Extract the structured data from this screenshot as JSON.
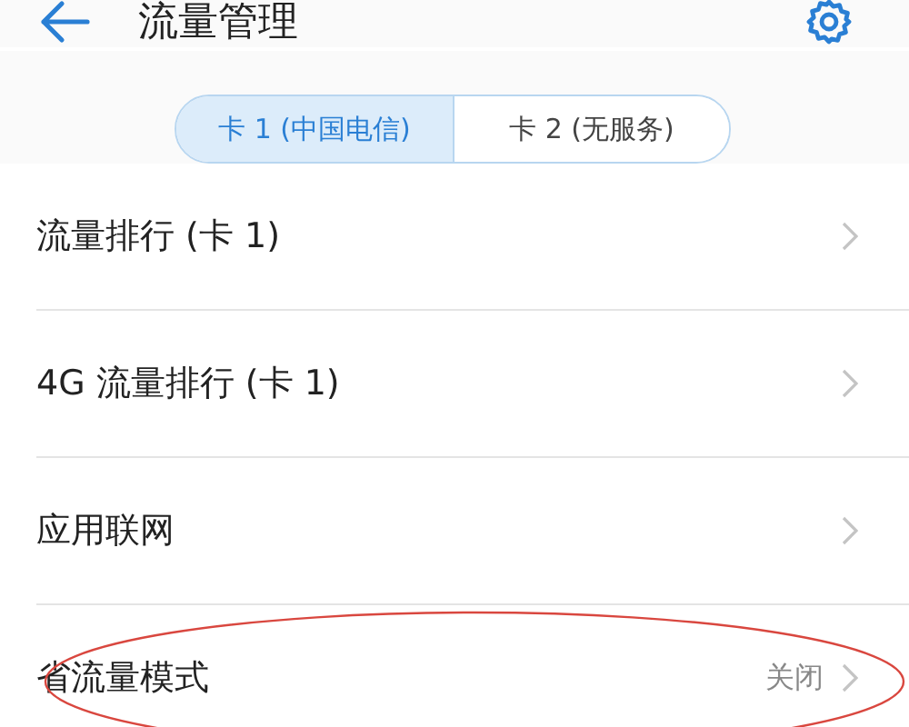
{
  "header": {
    "title": "流量管理"
  },
  "sim_tabs": [
    {
      "label": "卡 1 (中国电信)",
      "selected": true
    },
    {
      "label": "卡 2 (无服务)",
      "selected": false
    }
  ],
  "rows": [
    {
      "label": "流量排行 (卡 1)",
      "highlighted": false
    },
    {
      "label": "4G 流量排行 (卡 1)",
      "highlighted": false
    },
    {
      "label": "应用联网",
      "highlighted": false
    },
    {
      "label": "省流量模式",
      "value": "关闭",
      "highlighted": true
    }
  ]
}
